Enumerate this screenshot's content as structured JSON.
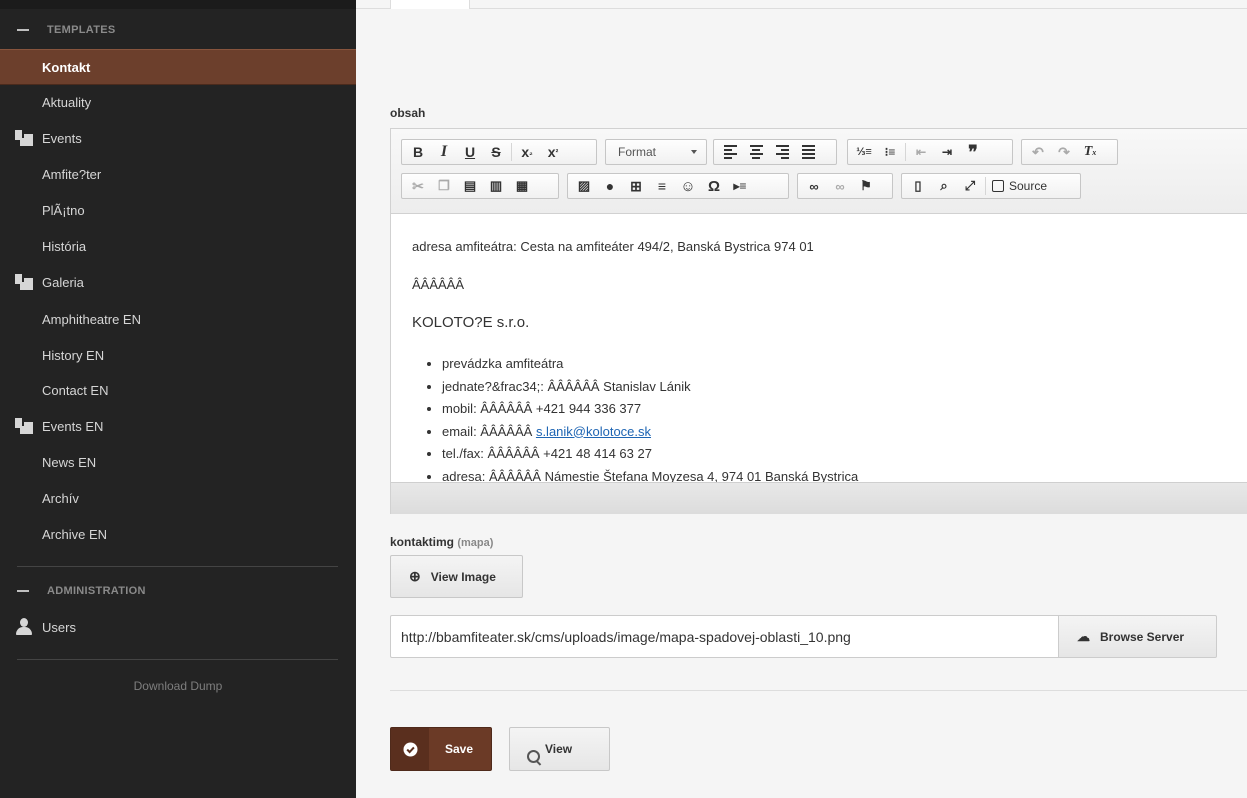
{
  "sidebar": {
    "templates_header": "TEMPLATES",
    "items": [
      {
        "label": "Kontakt",
        "active": true,
        "icon": null
      },
      {
        "label": "Aktuality",
        "icon": null
      },
      {
        "label": "Events",
        "icon": "stack-icon"
      },
      {
        "label": "Amfite?ter",
        "icon": null
      },
      {
        "label": "PlÃ¡tno",
        "icon": null
      },
      {
        "label": "História",
        "icon": null
      },
      {
        "label": "Galeria",
        "icon": "stack-icon"
      },
      {
        "label": "Amphitheatre EN",
        "icon": null
      },
      {
        "label": "History EN",
        "icon": null
      },
      {
        "label": "Contact EN",
        "icon": null
      },
      {
        "label": "Events EN",
        "icon": "stack-icon"
      },
      {
        "label": "News EN",
        "icon": null
      },
      {
        "label": "Archív",
        "icon": null
      },
      {
        "label": "Archive EN",
        "icon": null
      }
    ],
    "admin_header": "ADMINISTRATION",
    "users_label": "Users",
    "download_label": "Download Dump"
  },
  "main": {
    "obsah_label": "obsah",
    "editor": {
      "format_label": "Format",
      "source_label": "Source",
      "content": {
        "line1": "adresa amfiteátra: Cesta na amfiteáter 494/2, Banská Bystrica 974 01",
        "line2": "ÂÂÂÂÂÂ",
        "line3": "KOLOTO?E s.r.o.",
        "list": [
          "prevádzka amfiteátra",
          "jednate?&frac34;: ÂÂÂÂÂÂ Stanislav Lánik",
          "mobil: ÂÂÂÂÂÂ +421 944 336 377",
          "email: ÂÂÂÂÂÂ ",
          "tel./fax: ÂÂÂÂÂÂ +421 48 414 63 27",
          "adresa: ÂÂÂÂÂÂ Námestie Štefana Moyzesa 4, 974 01 Banská Bystrica"
        ],
        "email_link": "s.lanik@kolotoce.sk"
      }
    },
    "kontaktimg_label": "kontaktimg",
    "kontaktimg_sub": "(mapa)",
    "view_image_label": "View Image",
    "image_url": "http://bbamfiteater.sk/cms/uploads/image/mapa-spadovej-oblasti_10.png",
    "browse_label": "Browse Server",
    "save_label": "Save",
    "view_label": "View"
  },
  "colors": {
    "accent": "#6c3f2c",
    "sidebar_bg": "#232323",
    "link": "#1e65b3"
  }
}
